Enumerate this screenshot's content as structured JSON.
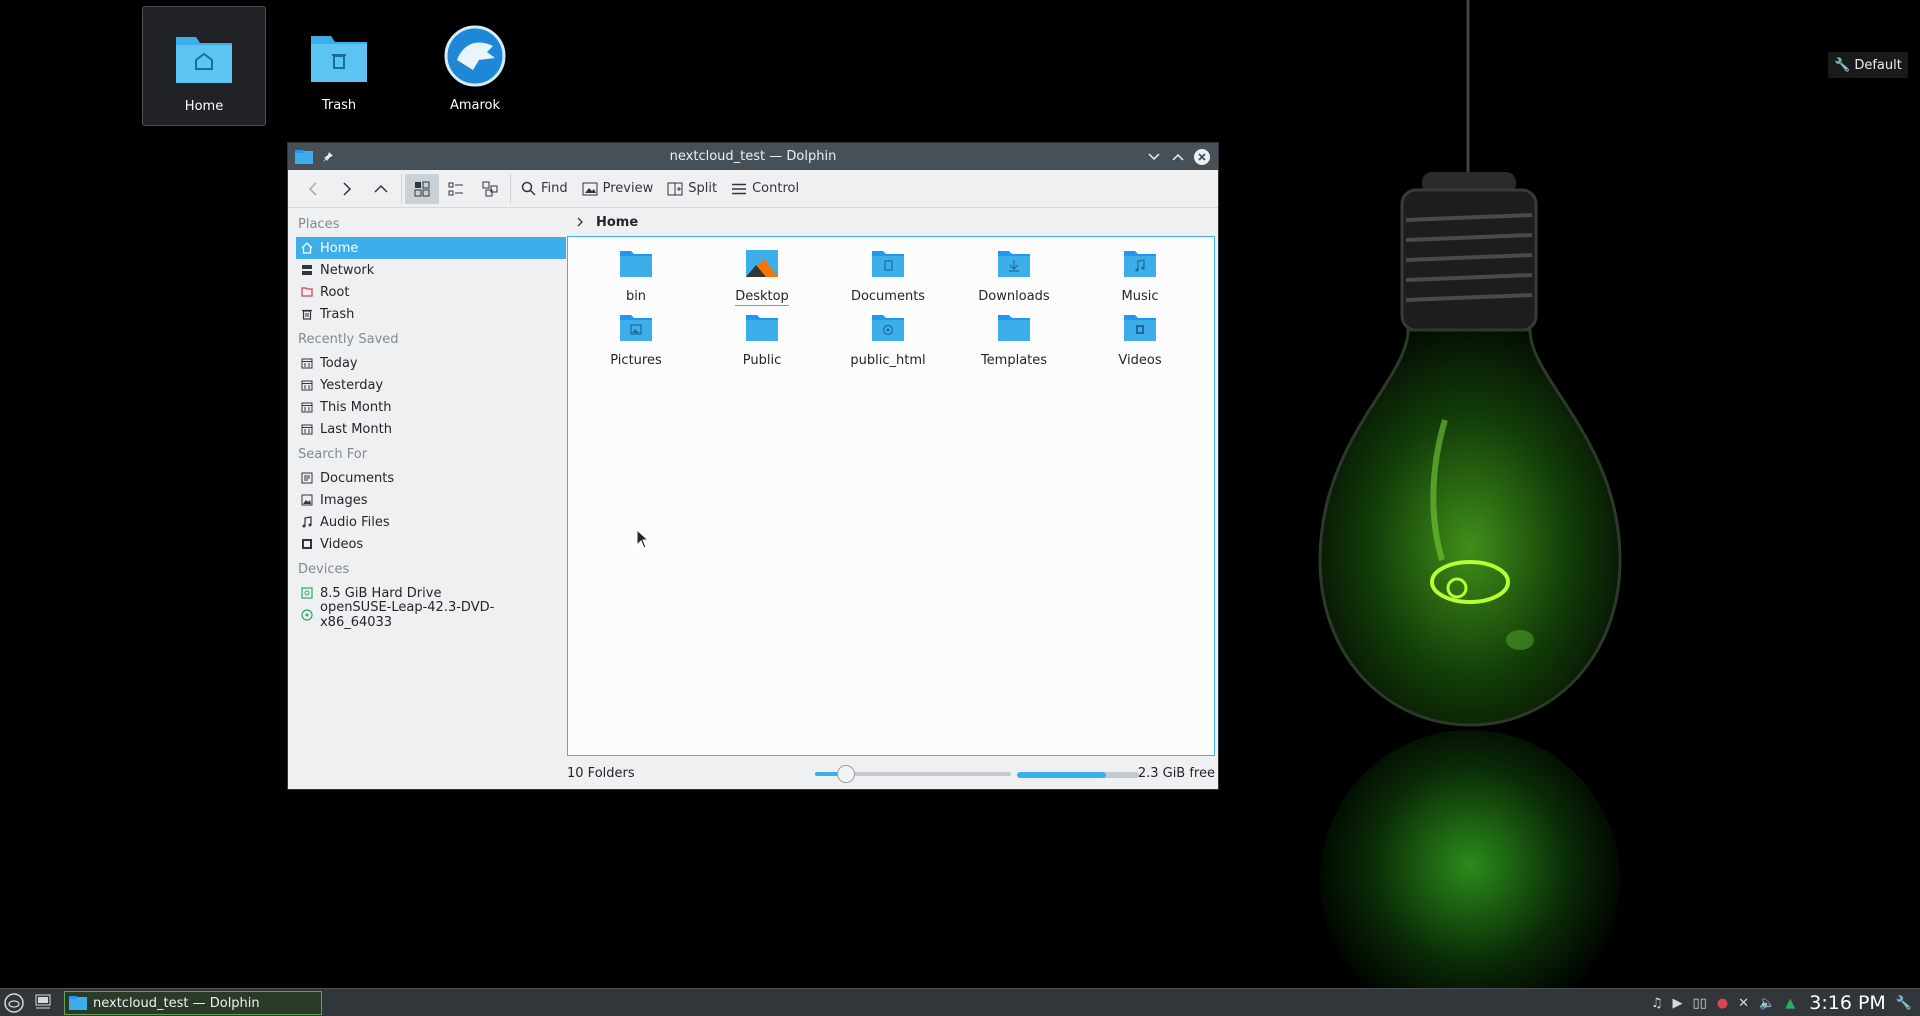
{
  "desktop": {
    "icons": [
      {
        "label": "Home",
        "icon": "home-folder-icon"
      },
      {
        "label": "Trash",
        "icon": "trash-folder-icon"
      },
      {
        "label": "Amarok",
        "icon": "amarok-wolf-icon"
      }
    ],
    "plasma_button": "Default"
  },
  "window": {
    "title": "nextcloud_test — Dolphin",
    "toolbar": {
      "find": "Find",
      "preview": "Preview",
      "split": "Split",
      "control": "Control"
    },
    "breadcrumb": "Home",
    "sidebar": {
      "places_header": "Places",
      "places": [
        "Home",
        "Network",
        "Root",
        "Trash"
      ],
      "recent_header": "Recently Saved",
      "recent": [
        "Today",
        "Yesterday",
        "This Month",
        "Last Month"
      ],
      "search_header": "Search For",
      "search": [
        "Documents",
        "Images",
        "Audio Files",
        "Videos"
      ],
      "devices_header": "Devices",
      "devices": [
        "8.5 GiB Hard Drive",
        "openSUSE-Leap-42.3-DVD-x86_64033"
      ]
    },
    "files": [
      "bin",
      "Desktop",
      "Documents",
      "Downloads",
      "Music",
      "Pictures",
      "Public",
      "public_html",
      "Templates",
      "Videos"
    ],
    "status": {
      "folders": "10 Folders",
      "free": "2.3 GiB free",
      "zoom_fraction": 0.16,
      "used_fraction": 0.73
    }
  },
  "taskbar": {
    "task": "nextcloud_test — Dolphin",
    "clock": "3:16 PM"
  },
  "colors": {
    "accent": "#3daee9",
    "titlebar": "#475057",
    "folder": "#3daee9"
  }
}
